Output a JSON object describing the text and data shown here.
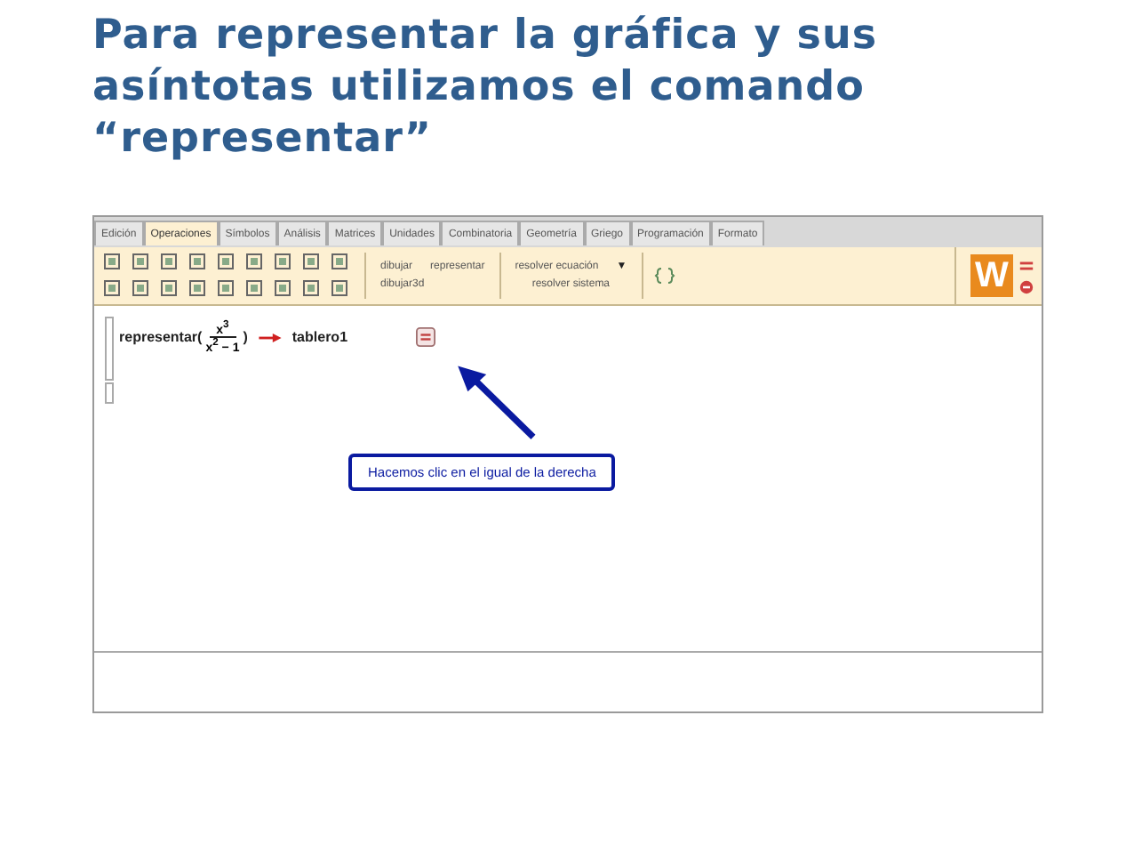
{
  "slide_title": "Para representar la gráfica y sus asíntotas utilizamos el comando “representar”",
  "tabs": [
    {
      "label": "Edición",
      "selected": false
    },
    {
      "label": "Operaciones",
      "selected": true
    },
    {
      "label": "Símbolos",
      "selected": false
    },
    {
      "label": "Análisis",
      "selected": false
    },
    {
      "label": "Matrices",
      "selected": false
    },
    {
      "label": "Unidades",
      "selected": false
    },
    {
      "label": "Combinatoria",
      "selected": false
    },
    {
      "label": "Geometría",
      "selected": false
    },
    {
      "label": "Griego",
      "selected": false
    },
    {
      "label": "Programación",
      "selected": false
    },
    {
      "label": "Formato",
      "selected": false
    }
  ],
  "toolbar": {
    "commands_top": [
      "dibujar",
      "representar"
    ],
    "commands_bottom": [
      "dibujar3d"
    ],
    "solve_top": "resolver ecuación",
    "solve_menu": "▼",
    "solve_bottom": "resolver sistema",
    "logo": "W"
  },
  "formula": {
    "function": "representar(",
    "numerator": "x$^{3}$",
    "denominator": "x$^{2}$ − 1",
    "close": ")",
    "result": "tablero1"
  },
  "callout": "Hacemos clic en el igual de la derecha"
}
